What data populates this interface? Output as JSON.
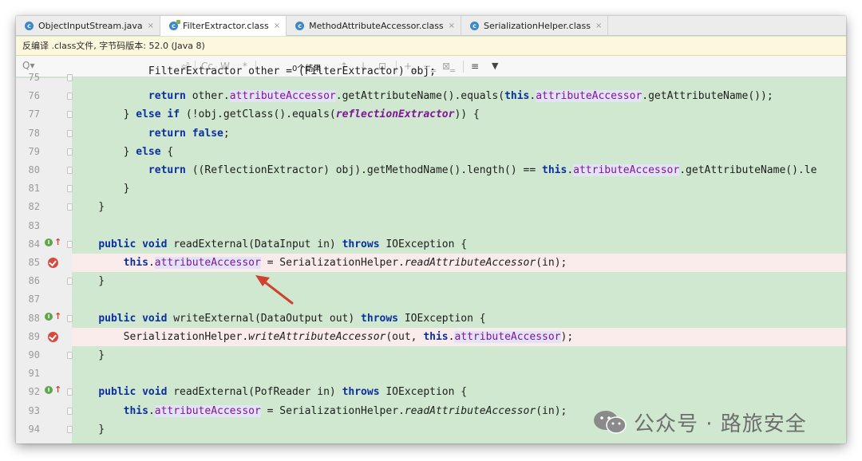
{
  "tabs": [
    {
      "label": "ObjectInputStream.java",
      "active": false,
      "locked": false
    },
    {
      "label": "FilterExtractor.class",
      "active": true,
      "locked": true
    },
    {
      "label": "MethodAttributeAccessor.class",
      "active": false,
      "locked": false
    },
    {
      "label": "SerializationHelper.class",
      "active": false,
      "locked": false
    }
  ],
  "notice": {
    "text": "反编译 .class文件, 字节码版本: 52.0 (Java 8)"
  },
  "findbar": {
    "search_icon": "Q▾",
    "newline_icon": "⏎",
    "match_case": "Cc",
    "whole_words": "W",
    "regex": ".*",
    "results": "0个结果",
    "prev_icon": "↑",
    "next_icon": "↓",
    "select_all_icon": "⊡",
    "add_occurrence_icon": "+‗",
    "remove_occurrence_icon": "−‗",
    "toggle_occurrence_icon": "⊠‗",
    "multiline_icon": "≡",
    "filter_icon": "▼"
  },
  "code_lines": [
    {
      "num": "75",
      "tokens": [
        {
          "t": "            FilterExtractor other = (FilterExtractor) obj;"
        }
      ],
      "partial": true
    },
    {
      "num": "76",
      "tokens": [
        {
          "t": "            "
        },
        {
          "t": "return",
          "c": "kw"
        },
        {
          "t": " other."
        },
        {
          "t": "attributeAccessor",
          "c": "fld"
        },
        {
          "t": ".getAttributeName().equals("
        },
        {
          "t": "this",
          "c": "kw"
        },
        {
          "t": "."
        },
        {
          "t": "attributeAccessor",
          "c": "fld"
        },
        {
          "t": ".getAttributeName());"
        }
      ]
    },
    {
      "num": "77",
      "tokens": [
        {
          "t": "        } "
        },
        {
          "t": "else if",
          "c": "kw"
        },
        {
          "t": " (!obj.getClass().equals("
        },
        {
          "t": "reflectionExtractor",
          "c": "ital-fld"
        },
        {
          "t": ")) {"
        }
      ]
    },
    {
      "num": "78",
      "tokens": [
        {
          "t": "            "
        },
        {
          "t": "return false",
          "c": "kw"
        },
        {
          "t": ";"
        }
      ]
    },
    {
      "num": "79",
      "tokens": [
        {
          "t": "        } "
        },
        {
          "t": "else",
          "c": "kw"
        },
        {
          "t": " {"
        }
      ]
    },
    {
      "num": "80",
      "tokens": [
        {
          "t": "            "
        },
        {
          "t": "return",
          "c": "kw"
        },
        {
          "t": " ((ReflectionExtractor) obj).getMethodName().length() == "
        },
        {
          "t": "this",
          "c": "kw"
        },
        {
          "t": "."
        },
        {
          "t": "attributeAccessor",
          "c": "fld"
        },
        {
          "t": ".getAttributeName().le"
        }
      ]
    },
    {
      "num": "81",
      "tokens": [
        {
          "t": "        }"
        }
      ]
    },
    {
      "num": "82",
      "tokens": [
        {
          "t": "    }"
        }
      ]
    },
    {
      "num": "83",
      "tokens": [
        {
          "t": ""
        }
      ]
    },
    {
      "num": "84",
      "tokens": [
        {
          "t": "    "
        },
        {
          "t": "public void",
          "c": "kw"
        },
        {
          "t": " readExternal(DataInput in) "
        },
        {
          "t": "throws",
          "c": "kw"
        },
        {
          "t": " IOException {"
        }
      ],
      "impl": true
    },
    {
      "num": "85",
      "tokens": [
        {
          "t": "        "
        },
        {
          "t": "this",
          "c": "kw"
        },
        {
          "t": "."
        },
        {
          "t": "attributeAccessor",
          "c": "fld"
        },
        {
          "t": " = SerializationHelper."
        },
        {
          "t": "readAttributeAccessor",
          "c": "ital"
        },
        {
          "t": "(in);"
        }
      ],
      "breakpoint": true
    },
    {
      "num": "86",
      "tokens": [
        {
          "t": "    }"
        }
      ]
    },
    {
      "num": "87",
      "tokens": [
        {
          "t": ""
        }
      ]
    },
    {
      "num": "88",
      "tokens": [
        {
          "t": "    "
        },
        {
          "t": "public void",
          "c": "kw"
        },
        {
          "t": " writeExternal(DataOutput out) "
        },
        {
          "t": "throws",
          "c": "kw"
        },
        {
          "t": " IOException {"
        }
      ],
      "impl": true
    },
    {
      "num": "89",
      "tokens": [
        {
          "t": "        SerializationHelper."
        },
        {
          "t": "writeAttributeAccessor",
          "c": "ital"
        },
        {
          "t": "(out, "
        },
        {
          "t": "this",
          "c": "kw"
        },
        {
          "t": "."
        },
        {
          "t": "attributeAccessor",
          "c": "fld"
        },
        {
          "t": ");"
        }
      ],
      "breakpoint": true
    },
    {
      "num": "90",
      "tokens": [
        {
          "t": "    }"
        }
      ]
    },
    {
      "num": "91",
      "tokens": [
        {
          "t": ""
        }
      ]
    },
    {
      "num": "92",
      "tokens": [
        {
          "t": "    "
        },
        {
          "t": "public void",
          "c": "kw"
        },
        {
          "t": " readExternal(PofReader in) "
        },
        {
          "t": "throws",
          "c": "kw"
        },
        {
          "t": " IOException {"
        }
      ],
      "impl": true
    },
    {
      "num": "93",
      "tokens": [
        {
          "t": "        "
        },
        {
          "t": "this",
          "c": "kw"
        },
        {
          "t": "."
        },
        {
          "t": "attributeAccessor",
          "c": "fld"
        },
        {
          "t": " = SerializationHelper."
        },
        {
          "t": "readAttributeAccessor",
          "c": "ital"
        },
        {
          "t": "(in);"
        }
      ]
    },
    {
      "num": "94",
      "tokens": [
        {
          "t": "    }"
        }
      ]
    }
  ],
  "watermark": {
    "text": "公众号 · 路旅安全"
  },
  "colors": {
    "code_bg": "#cfe8cf",
    "keyword": "#0b2fa0",
    "field": "#81149a",
    "breakpoint_line": "#faeceb",
    "arrow": "#d0412f"
  }
}
